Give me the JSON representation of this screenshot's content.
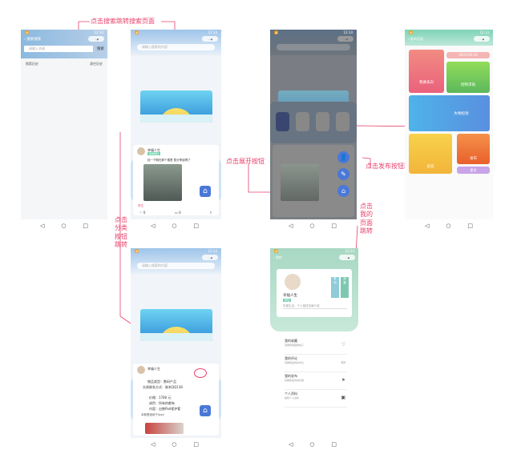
{
  "annotations": {
    "search_jump": "点击搜索跳转搜索页面",
    "category_jump": "点击\n分类\n按钮\n跳转",
    "expand_button": "点击展开按钮",
    "publish_jump": "点击发布按钮跳转",
    "mypage_jump": "点击\n我的\n页面\n跳转"
  },
  "status_time": "12:14",
  "search_page": {
    "title": "搜索搜索",
    "input_placeholder": "请输入关键",
    "search_button": "搜索",
    "history_label": "搜索历史",
    "clear_history": "清空历史"
  },
  "home": {
    "search_placeholder": "请输入搜索的内容",
    "category_title": "分类分类",
    "categories": [
      "全部\n动态",
      "失物\n招领",
      "表白\n墙",
      "发布\n求助"
    ],
    "post": {
      "username": "幸福人生",
      "tag": "失物招领",
      "text": "捡一下刚在那个楼里 暂分享给啊了",
      "location": "学生",
      "likes": "0",
      "comments": "0"
    }
  },
  "detail_home": {
    "category_title": "分类分类",
    "post": {
      "username": "幸福人生",
      "field1": "物品类型：",
      "field1v": "数码产品",
      "field2": "交易联系方式：",
      "field2v": "联系QQ136",
      "field3": "价格：",
      "field3v": "1780 元",
      "field4": "成色：",
      "field4v": "所有的都有",
      "field5": "内容：",
      "field5v": "出售Pad保护套",
      "extra": "本款是适用于ipad"
    }
  },
  "publish_page": {
    "title": "发布页面",
    "tiles": [
      "我要表白",
      "2023-05-29",
      "招物求助",
      "失物招领",
      "发布",
      "说说",
      "更多"
    ]
  },
  "my_page": {
    "title": "我的",
    "username": "幸福人生",
    "badge": "学生",
    "bio": "热爱生活，个人描述页面介绍",
    "side_badges": [
      "签\n到",
      "设\n置"
    ],
    "menu": [
      {
        "t1": "我的收藏",
        "t2": "查看我收藏的帖子"
      },
      {
        "t1": "我的评论",
        "t2": "查看我发布的评论"
      },
      {
        "t1": "我的发布",
        "t2": "查看我发布的内容"
      },
      {
        "t1": "个人资料",
        "t2": "编辑个人资料"
      }
    ]
  }
}
